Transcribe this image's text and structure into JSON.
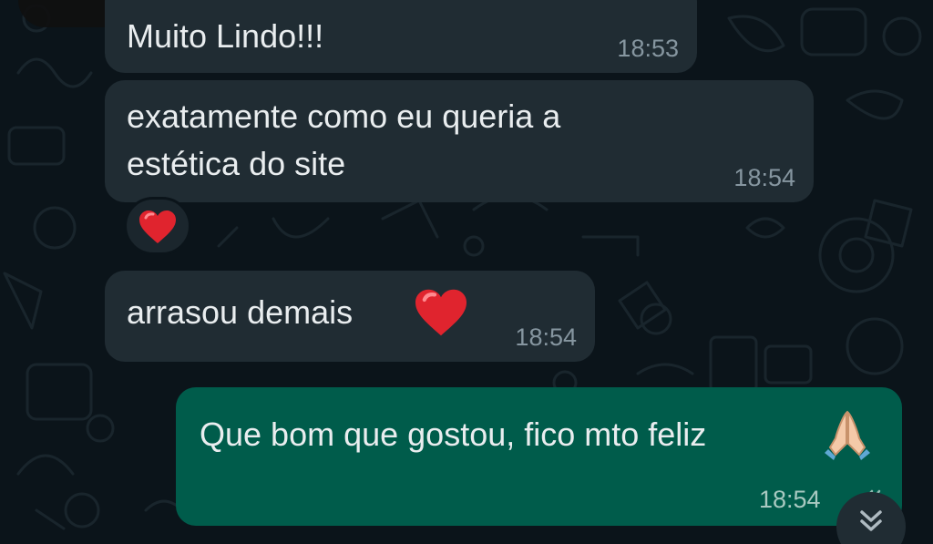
{
  "colors": {
    "background": "#0b141a",
    "incoming_bubble": "#202c33",
    "outgoing_bubble": "#005c4b",
    "text": "#e9edef",
    "timestamp": "#8696a0"
  },
  "messages": [
    {
      "direction": "incoming",
      "text": "Muito Lindo!!!",
      "time": "18:53"
    },
    {
      "direction": "incoming",
      "lines": [
        "exatamente como eu queria a",
        "estética do site"
      ],
      "time": "18:54",
      "reaction": "heart"
    },
    {
      "direction": "incoming",
      "text": "arrasou demais",
      "emoji": "heart",
      "time": "18:54"
    },
    {
      "direction": "outgoing",
      "text": "Que bom que gostou, fico mto feliz",
      "emoji": "folded-hands",
      "time": "18:54",
      "status": "double-check"
    }
  ],
  "scroll_button": {
    "icon": "double-chevron-down-icon"
  }
}
